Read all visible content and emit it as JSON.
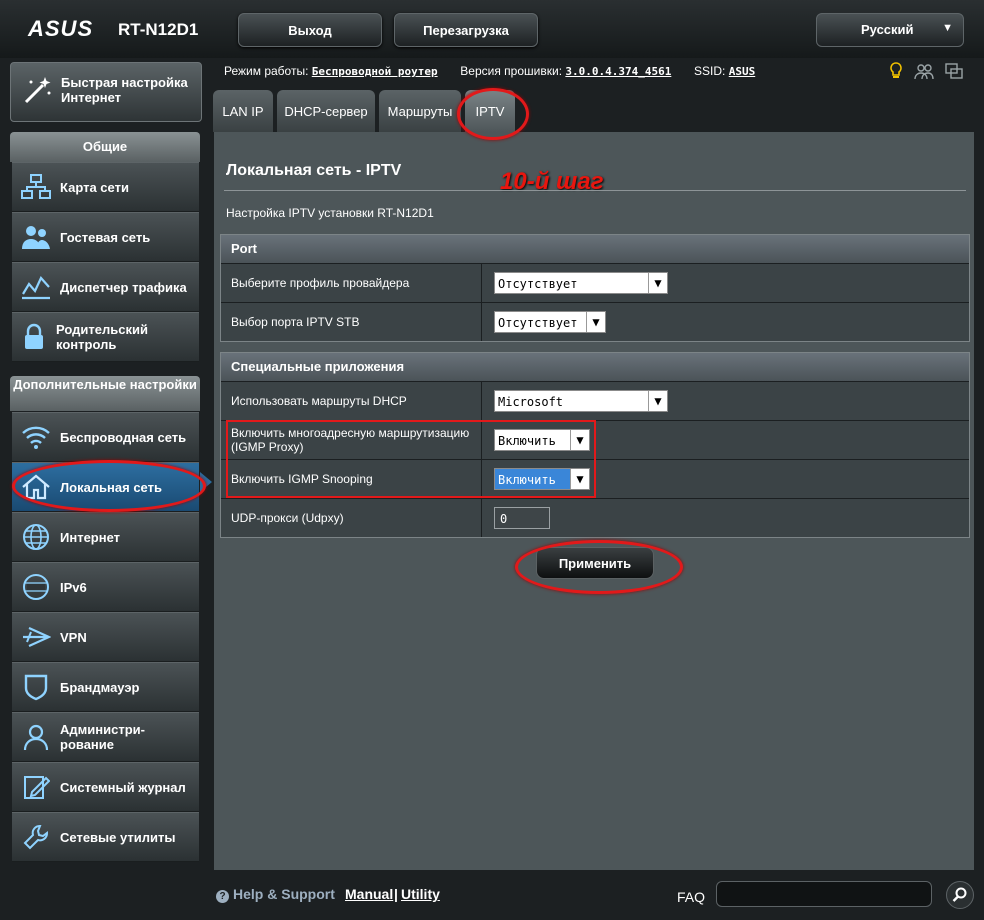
{
  "header": {
    "brand": "ASUS",
    "model": "RT-N12D1",
    "logout_label": "Выход",
    "reboot_label": "Перезагрузка",
    "language": "Русский"
  },
  "status": {
    "mode_label": "Режим работы:",
    "mode_value": "Беспроводной роутер",
    "firmware_label": "Версия прошивки:",
    "firmware_value": "3.0.0.4.374_4561",
    "ssid_label": "SSID:",
    "ssid_value": "ASUS"
  },
  "sidebar": {
    "quick_setup": "Быстрая настройка Интернет",
    "general_header": "Общие",
    "general_items": [
      {
        "label": "Карта сети"
      },
      {
        "label": "Гостевая сеть"
      },
      {
        "label": "Диспетчер трафика"
      },
      {
        "label": "Родительский контроль"
      }
    ],
    "advanced_header": "Дополнительные настройки",
    "advanced_items": [
      {
        "label": "Беспроводная сеть"
      },
      {
        "label": "Локальная сеть"
      },
      {
        "label": "Интернет"
      },
      {
        "label": "IPv6"
      },
      {
        "label": "VPN"
      },
      {
        "label": "Брандмауэр"
      },
      {
        "label": "Администри-рование"
      },
      {
        "label": "Системный журнал"
      },
      {
        "label": "Сетевые утилиты"
      }
    ]
  },
  "tabs": [
    {
      "label": "LAN IP"
    },
    {
      "label": "DHCP-сервер"
    },
    {
      "label": "Маршруты"
    },
    {
      "label": "IPTV"
    }
  ],
  "main": {
    "title": "Локальная сеть - IPTV",
    "annotation": "10-й шаг",
    "description": "Настройка IPTV установки RT-N12D1",
    "port_header": "Port",
    "port_rows": [
      {
        "label": "Выберите профиль провайдера",
        "value": "Отсутствует"
      },
      {
        "label": "Выбор порта IPTV STB",
        "value": "Отсутствует"
      }
    ],
    "special_header": "Специальные приложения",
    "special_rows": [
      {
        "label": "Использовать маршруты DHCP",
        "value": "Microsoft"
      },
      {
        "label": "Включить многоадресную маршрутизацию (IGMP Proxy)",
        "value": "Включить"
      },
      {
        "label": "Включить IGMP Snooping",
        "value": "Включить"
      },
      {
        "label": "UDP-прокси (Udpxy)",
        "value": "0"
      }
    ],
    "apply_label": "Применить"
  },
  "footer": {
    "help": "Help & Support",
    "manual": "Manual",
    "separator": "|",
    "utility": "Utility",
    "faq": "FAQ"
  },
  "colors": {
    "annotation_red": "#e2191a",
    "active_nav": "#2d6ea0",
    "selected_option": "#3a86d8"
  }
}
